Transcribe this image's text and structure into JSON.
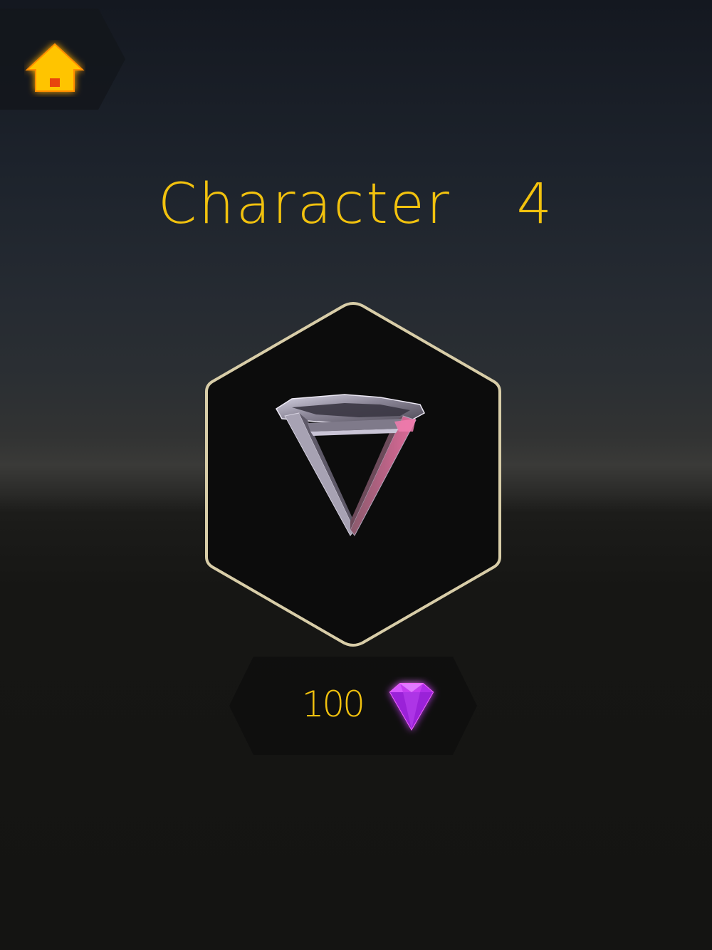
{
  "header": {
    "home_icon": "home-icon"
  },
  "character": {
    "title": "Character  4",
    "preview": "inverted-triangle-crystal"
  },
  "price": {
    "amount": "100",
    "currency_icon": "purple-gem-icon"
  },
  "colors": {
    "accent": "#f2c20e",
    "hex_border": "#d8cda8",
    "gem": "#c43cf0",
    "home_glow": "#ff9a00"
  }
}
